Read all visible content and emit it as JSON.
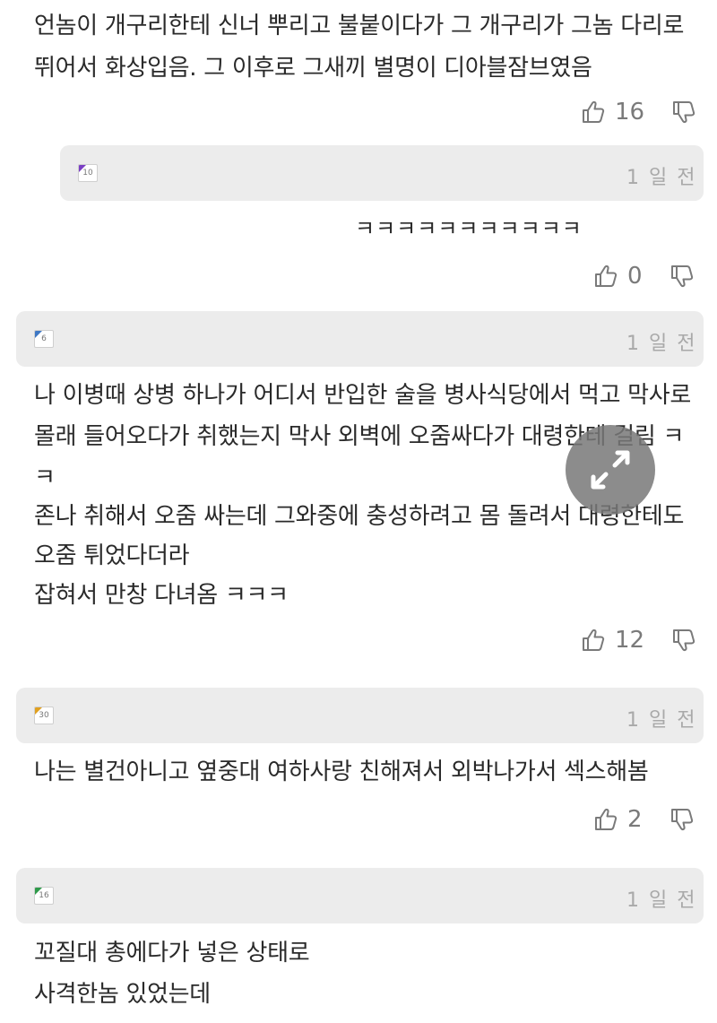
{
  "comments": {
    "c1": {
      "lines": [
        "언놈이 개구리한테 신너 뿌리고 불붙이다가 그 개구리가 그놈 다리로",
        "뛰어서 화상입음. 그 이후로 그새끼 별명이 디아블잠브였음"
      ],
      "likes": "16"
    },
    "c2": {
      "level": "10",
      "level_color": "#7b3fc4",
      "time": "1 일 전",
      "lines": [
        "ㅋㅋㅋㅋㅋㅋㅋㅋㅋㅋㅋ"
      ],
      "likes": "0"
    },
    "c3": {
      "level": "6",
      "level_color": "#3f78c4",
      "time": "1 일 전",
      "lines": [
        "나 이병때 상병 하나가 어디서 반입한 술을 병사식당에서 먹고 막사로",
        "몰래 들어오다가 취했는지 막사 외벽에 오줌싸다가 대령한테 걸림 ㅋ",
        "ㅋ",
        "존나 취해서 오줌 싸는데 그와중에 충성하려고 몸 돌려서 대령한테도",
        "오줌 튀었다더라",
        "잡혀서 만창 다녀옴 ㅋㅋㅋ"
      ],
      "likes": "12"
    },
    "c4": {
      "level": "30",
      "level_color": "#e0a020",
      "time": "1 일 전",
      "lines": [
        "나는 별건아니고 옆중대 여하사랑 친해져서 외박나가서 섹스해봄"
      ],
      "likes": "2"
    },
    "c5": {
      "level": "16",
      "level_color": "#2e9a4a",
      "time": "1 일 전",
      "lines": [
        "꼬질대 총에다가 넣은 상태로",
        "사격한놈 있었는데"
      ]
    }
  },
  "icons": {
    "like": "thumbs-up-icon",
    "dislike": "thumbs-down-icon",
    "expand": "expand-arrows-icon"
  },
  "colors": {
    "header_bar": "#ececec",
    "time_text": "#a9a9a9",
    "vote_text": "#7a7a7a"
  }
}
